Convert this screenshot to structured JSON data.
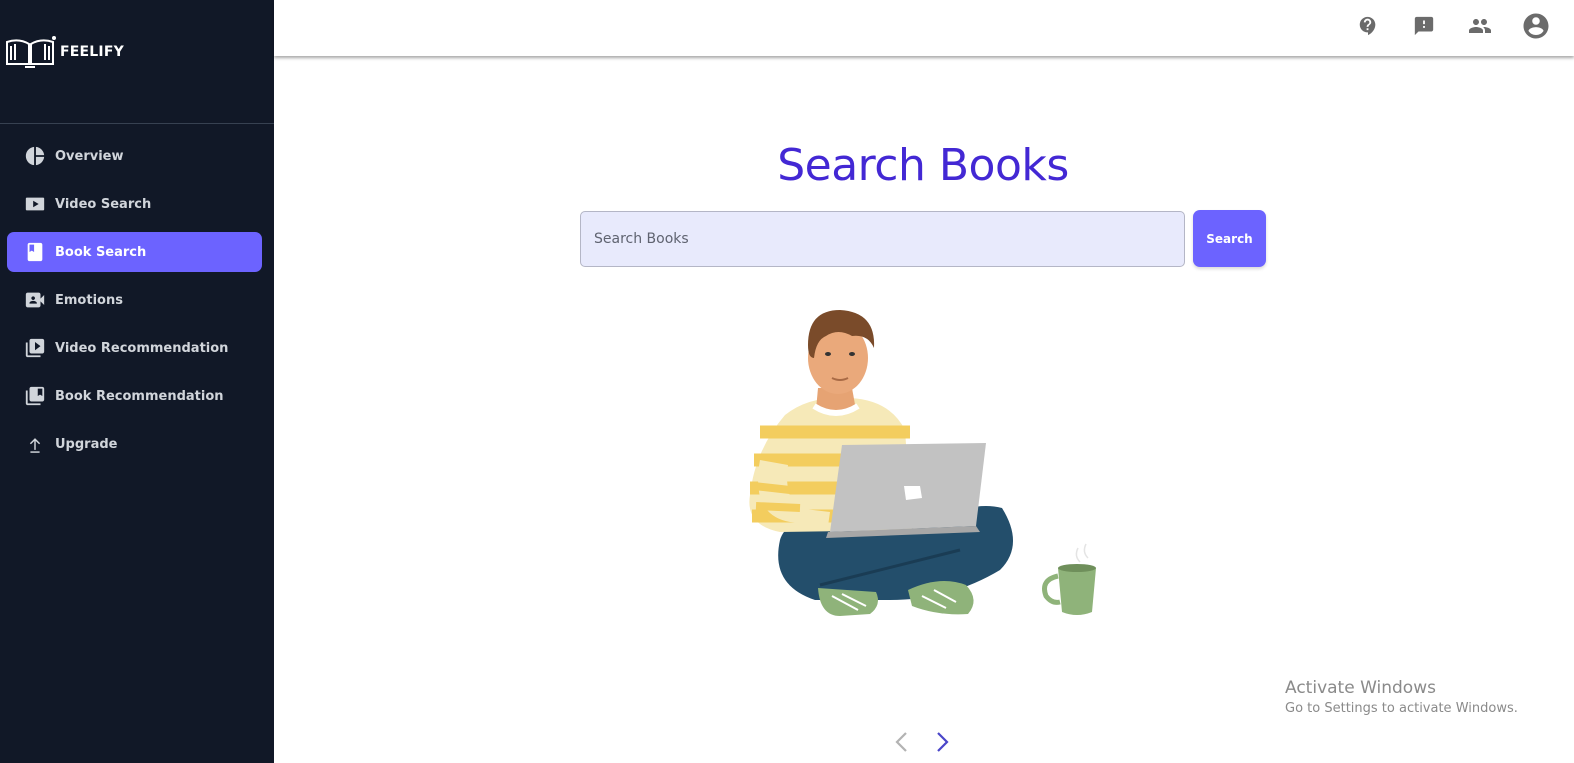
{
  "app": {
    "logo_text": "FEELIFY"
  },
  "sidebar": {
    "items": [
      {
        "label": "Overview",
        "icon": "pie-chart-icon",
        "active": false
      },
      {
        "label": "Video Search",
        "icon": "youtube-icon",
        "active": false
      },
      {
        "label": "Book Search",
        "icon": "book-icon",
        "active": true
      },
      {
        "label": "Emotions",
        "icon": "video-person-icon",
        "active": false
      },
      {
        "label": "Video Recommendation",
        "icon": "video-library-icon",
        "active": false
      },
      {
        "label": "Book Recommendation",
        "icon": "library-books-icon",
        "active": false
      },
      {
        "label": "Upgrade",
        "icon": "arrow-up-icon",
        "active": false
      }
    ]
  },
  "topbar": {
    "icons": [
      "help-icon",
      "feedback-icon",
      "people-icon",
      "account-icon"
    ]
  },
  "main": {
    "title": "Search Books",
    "search_placeholder": "Search Books",
    "search_button": "Search"
  },
  "watermark": {
    "title": "Activate Windows",
    "subtitle": "Go to Settings to activate Windows."
  },
  "colors": {
    "sidebar_bg": "#111827",
    "accent": "#6c63ff",
    "title": "#4328d4",
    "input_bg": "#e8eafc"
  }
}
